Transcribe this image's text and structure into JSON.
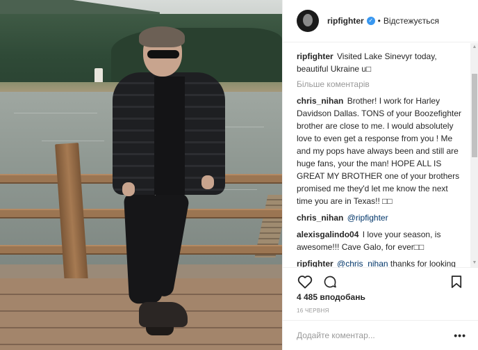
{
  "post": {
    "username": "ripfighter",
    "verified_badge": "verified-badge",
    "separator": "•",
    "follow_status": "Відстежується",
    "caption": {
      "user": "ripfighter",
      "text": "Visited Lake Sinevyr today, beautiful Ukraine u□"
    },
    "load_more_label": "Більше коментарів",
    "comments": [
      {
        "user": "chris_nihan",
        "text": "Brother! I work for Harley Davidson Dallas. TONS of your Boozefighter brother are close to me. I would absolutely love to even get a response from you ! Me and my pops have always been and still are huge fans, your the man! HOPE ALL IS GREAT MY BROTHER one of your brothers promised me they'd let me know the next time you are in Texas!! □□"
      },
      {
        "user": "chris_nihan",
        "mention": "@ripfighter",
        "text": ""
      },
      {
        "user": "alexisgalindo04",
        "text": "I love your season, is awesome!!! Cave Galo, for ever□□"
      },
      {
        "user": "ripfighter",
        "mention": "@chris_nihan",
        "text": "thanks for looking after my brothers and working for HD!"
      }
    ],
    "likes": "4 485 вподобань",
    "date": "16 червня",
    "add_comment_placeholder": "Додайте коментар...",
    "options_label": "•••",
    "icons": {
      "like": "heart-icon",
      "comment": "comment-icon",
      "save": "bookmark-icon"
    },
    "accent_color": "#3897f0"
  }
}
